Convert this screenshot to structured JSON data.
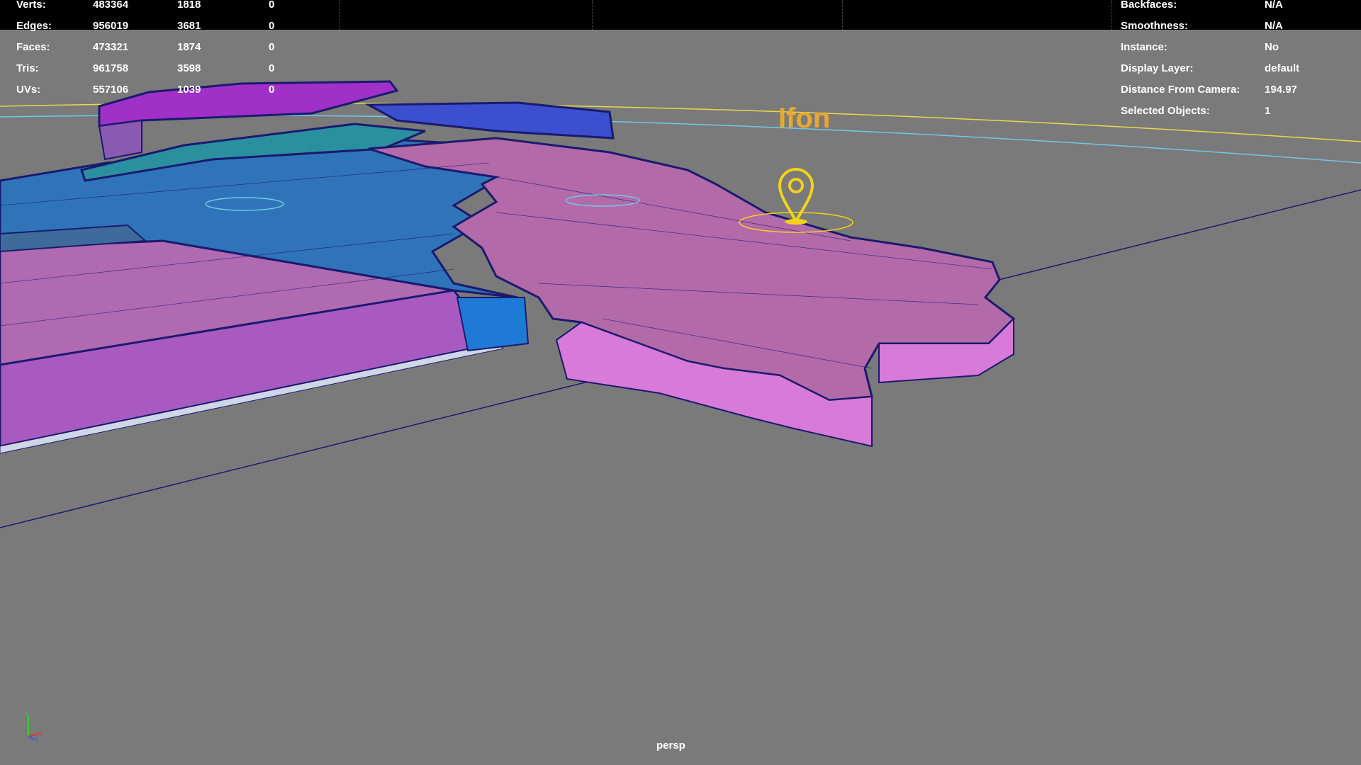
{
  "hud_left": {
    "rows": [
      {
        "label": "Verts:",
        "c1": "483364",
        "c2": "1818",
        "c3": "0"
      },
      {
        "label": "Edges:",
        "c1": "956019",
        "c2": "3681",
        "c3": "0"
      },
      {
        "label": "Faces:",
        "c1": "473321",
        "c2": "1874",
        "c3": "0"
      },
      {
        "label": "Tris:",
        "c1": "961758",
        "c2": "3598",
        "c3": "0"
      },
      {
        "label": "UVs:",
        "c1": "557106",
        "c2": "1039",
        "c3": "0"
      }
    ]
  },
  "hud_right": {
    "rows": [
      {
        "label": "Backfaces:",
        "value": "N/A"
      },
      {
        "label": "Smoothness:",
        "value": "N/A"
      },
      {
        "label": "Instance:",
        "value": "No"
      },
      {
        "label": "Display Layer:",
        "value": "default"
      },
      {
        "label": "Distance From Camera:",
        "value": "194.97"
      },
      {
        "label": "Selected Objects:",
        "value": "1"
      }
    ]
  },
  "scene": {
    "map_label": "Ifon",
    "marker_icon": "location-pin-icon",
    "colors": {
      "background": "#7a7a7a",
      "magenta_region": "#b26ab0",
      "blue_region": "#3a78b5",
      "teal_region": "#2a8f9f",
      "purple_region": "#a030c8",
      "wire": "#1a1a6e",
      "marker": "#f2d21a"
    }
  },
  "axis_gizmo": {
    "x": "x",
    "y": "y",
    "z": "z"
  },
  "camera_label": "persp"
}
